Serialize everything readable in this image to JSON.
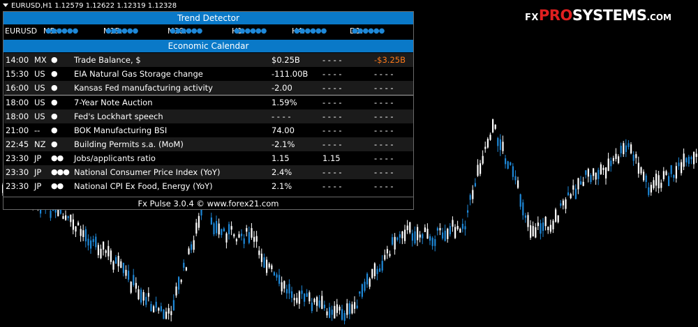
{
  "chart": {
    "symbol_line": "EURUSD,H1  1.12579 1.12622 1.12319 1.12328",
    "colors": {
      "bull": "#1e88d8",
      "bear": "#ffffff",
      "background": "#000000"
    }
  },
  "logo": {
    "fx": "FX",
    "pro": "PRO",
    "systems": "SYSTEMS",
    ".com": ".COM",
    "com": ".COM"
  },
  "trend_detector": {
    "title": "Trend Detector",
    "symbol": "EURUSD",
    "timeframes": [
      {
        "label": "M5:",
        "dots": "●●●●●●"
      },
      {
        "label": "M15:",
        "dots": "●●●●●●"
      },
      {
        "label": "M30:",
        "dots": "●●●●●●"
      },
      {
        "label": "H1:",
        "dots": "●●●●●●"
      },
      {
        "label": "H4:",
        "dots": "●●●●●●"
      },
      {
        "label": "D1:",
        "dots": "●●●●●●"
      }
    ]
  },
  "calendar": {
    "title": "Economic Calendar",
    "rows": [
      {
        "time": "14:00",
        "country": "MX",
        "impact": "●",
        "title": "Trade Balance, $",
        "actual": "$0.25B",
        "forecast": "- - - -",
        "previous": "-$3.25B"
      },
      {
        "time": "15:30",
        "country": "US",
        "impact": "●",
        "title": "EIA Natural Gas Storage change",
        "actual": "-111.00B",
        "forecast": "- - - -",
        "previous": "- - - -"
      },
      {
        "time": "16:00",
        "country": "US",
        "impact": "●",
        "title": "Kansas Fed manufacturing activity",
        "actual": "-2.00",
        "forecast": "- - - -",
        "previous": "- - - -"
      },
      {
        "time": "18:00",
        "country": "US",
        "impact": "●",
        "title": "7-Year Note Auction",
        "actual": "1.59%",
        "forecast": "- - - -",
        "previous": "- - - -"
      },
      {
        "time": "18:00",
        "country": "US",
        "impact": "●",
        "title": "Fed's Lockhart speech",
        "actual": "- - - -",
        "forecast": "- - - -",
        "previous": "- - - -"
      },
      {
        "time": "21:00",
        "country": "--",
        "impact": "●",
        "title": "BOK Manufacturing BSI",
        "actual": "74.00",
        "forecast": "- - - -",
        "previous": "- - - -"
      },
      {
        "time": "22:45",
        "country": "NZ",
        "impact": "●",
        "title": "Building Permits s.a. (MoM)",
        "actual": "-2.1%",
        "forecast": "- - - -",
        "previous": "- - - -"
      },
      {
        "time": "23:30",
        "country": "JP",
        "impact": "●●",
        "title": "Jobs/applicants ratio",
        "actual": "1.15",
        "forecast": "1.15",
        "previous": "- - - -"
      },
      {
        "time": "23:30",
        "country": "JP",
        "impact": "●●●",
        "title": "National Consumer Price Index (YoY)",
        "actual": "2.4%",
        "forecast": "- - - -",
        "previous": "- - - -"
      },
      {
        "time": "23:30",
        "country": "JP",
        "impact": "●●",
        "title": "National CPI Ex Food, Energy (YoY)",
        "actual": "2.1%",
        "forecast": "- - - -",
        "previous": "- - - -"
      }
    ]
  },
  "footer": "Fx Pulse 3.0.4 © www.forex21.com"
}
